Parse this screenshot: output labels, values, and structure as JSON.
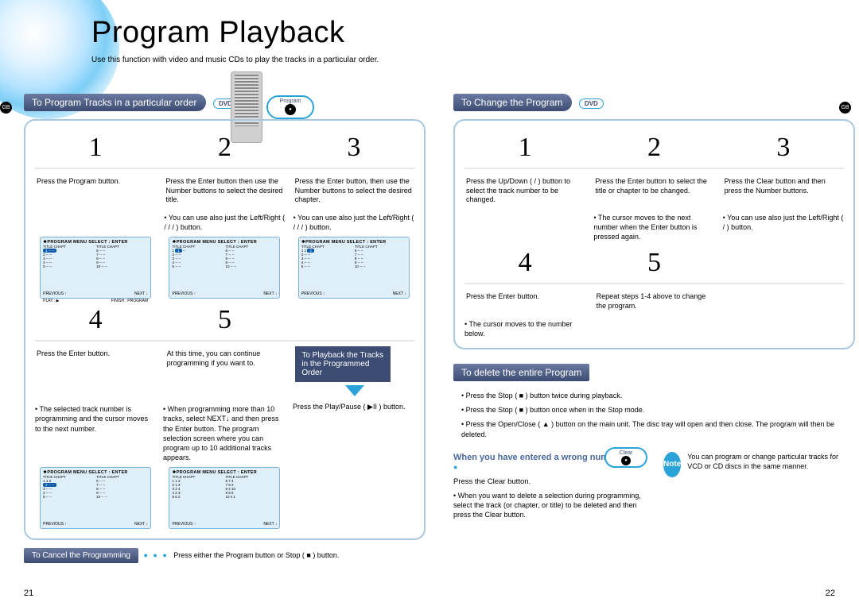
{
  "header": {
    "title": "Program Playback",
    "subtitle": "Use this function with video and music CDs to play the tracks in a particular order."
  },
  "labels": {
    "dvd": "DVD",
    "gb": "GB",
    "program_btn": "Program",
    "clear_btn": "Clear"
  },
  "pagenums": {
    "left": "21",
    "right": "22"
  },
  "left": {
    "section_title": "To Program Tracks in a particular order",
    "steps": {
      "s1": {
        "num": "1",
        "text": "Press the Program  button."
      },
      "s2": {
        "num": "2",
        "text": "Press the Enter  button then use the Number buttons to select the desired title.",
        "note": "You can use  also just the Left/Right (   /   /   /   ) button."
      },
      "s3": {
        "num": "3",
        "text": "Press the Enter  button, then use the Number buttons to select the desired chapter.",
        "note": "You can use also just the Left/Right (   /   /   /   ) button."
      },
      "s4": {
        "num": "4",
        "text": "Press the Enter  button.",
        "note": "The selected track number is programming and the cursor moves to the next number."
      },
      "s5": {
        "num": "5",
        "text": "At this time, you can continue programming if you want to.",
        "note": "When programming more than 10 tracks, select NEXT↓ and then press the Enter  button. The program selection screen where you can program up to 10 additional tracks appears."
      }
    },
    "playback_callout": "To Playback the Tracks in the Programmed Order",
    "playback_text": "Press the Play/Pause ( ▶II ) button.",
    "cancel": {
      "title": "To Cancel the Programming",
      "text": "Press either the Program  button or Stop ( ■ ) button."
    },
    "screen": {
      "header": "❖PROGRAM MENU   SELECT : ENTER",
      "colhdr": "TITLE CHAPT",
      "footer_prev": "PREVIOUS ↑",
      "footer_next": "NEXT ↓",
      "footer_play": "PLAY : ▶",
      "footer_finish": "FINISH : PROGRAM"
    }
  },
  "right": {
    "section_title": "To Change the Program",
    "steps": {
      "s1": {
        "num": "1",
        "text": "Press the Up/Down (   /   ) button to select the track number to be changed."
      },
      "s2": {
        "num": "2",
        "text": "Press the Enter  button to select the title or chapter to be changed.",
        "note": "The cursor moves to the next number when the Enter  button is pressed again."
      },
      "s3": {
        "num": "3",
        "text": "Press the Clear  button and then press the Number buttons.",
        "note": "You can use also just the Left/Right (   /   ) button."
      },
      "s4": {
        "num": "4",
        "text": "Press the Enter  button.",
        "note": "The cursor moves to the number below."
      },
      "s5": {
        "num": "5",
        "text": "Repeat steps 1-4 above to change the program."
      }
    },
    "delete": {
      "title": "To delete the entire Program",
      "b1": "Press the Stop  ( ■ ) button twice during playback.",
      "b2": "Press the Stop  ( ■ ) button once when in the Stop mode.",
      "b3": "Press the Open/Close  ( ▲ ) button on the main unit. The disc tray will open and then close. The program will then be deleted."
    },
    "wrong": {
      "title": "When you have entered a wrong number",
      "press": "Press the Clear button.",
      "note": "When you want to delete a selection during programming, select the track (or chapter, or title) to be deleted and then press the Clear  button."
    },
    "footnote": {
      "label": "Note",
      "text": "You can program or change particular tracks for VCD or CD discs in the same manner."
    }
  }
}
